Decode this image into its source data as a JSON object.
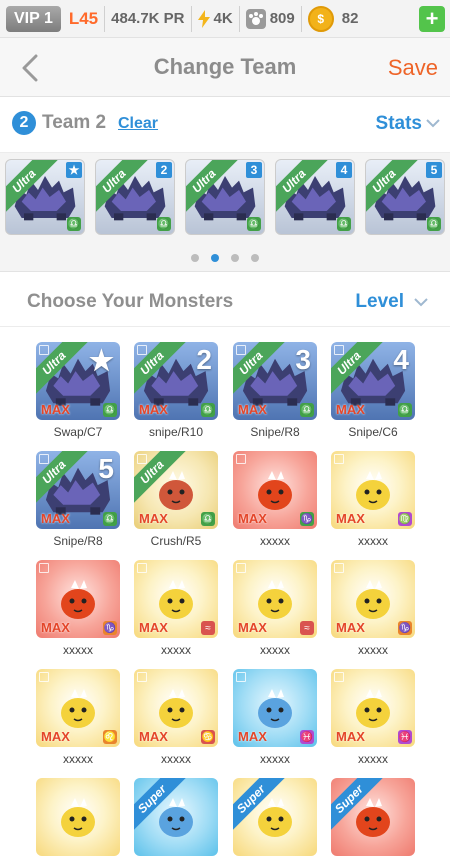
{
  "status": {
    "vip": "VIP 1",
    "level": "L45",
    "power": "484.7K PR",
    "energy": "4K",
    "food": "809",
    "gold": "82",
    "colors": {
      "accent": "#ee6428",
      "blue": "#2f8fd8",
      "green": "#4ba55a"
    }
  },
  "nav": {
    "title": "Change Team",
    "save": "Save"
  },
  "team": {
    "number": "2",
    "name": "Team 2",
    "clear": "Clear",
    "stats": "Stats"
  },
  "team_slots": [
    {
      "rank": "Ultra",
      "badge": "★"
    },
    {
      "rank": "Ultra",
      "badge": "2"
    },
    {
      "rank": "Ultra",
      "badge": "3"
    },
    {
      "rank": "Ultra",
      "badge": "4"
    },
    {
      "rank": "Ultra",
      "badge": "5"
    }
  ],
  "pager": {
    "active_index": 1,
    "count": 4
  },
  "monsters": {
    "title": "Choose Your Monsters",
    "sort": "Level"
  },
  "cards": [
    {
      "name": "Swap/C7",
      "rank": "Ultra",
      "badge": "★",
      "level": "MAX",
      "theme": "blue"
    },
    {
      "name": "snipe/R10",
      "rank": "Ultra",
      "badge": "2",
      "level": "MAX",
      "theme": "blue"
    },
    {
      "name": "Snipe/R8",
      "rank": "Ultra",
      "badge": "3",
      "level": "MAX",
      "theme": "blue"
    },
    {
      "name": "Snipe/C6",
      "rank": "Ultra",
      "badge": "4",
      "level": "MAX",
      "theme": "blue"
    },
    {
      "name": "Snipe/R8",
      "rank": "Ultra",
      "badge": "5",
      "level": "MAX",
      "theme": "blue"
    },
    {
      "name": "Crush/R5",
      "rank": "Ultra",
      "badge": "",
      "level": "MAX",
      "theme": "green"
    },
    {
      "name": "xxxxx",
      "rank": "",
      "badge": "",
      "level": "MAX",
      "theme": "red"
    },
    {
      "name": "xxxxx",
      "rank": "",
      "badge": "",
      "level": "MAX",
      "theme": "yellow"
    },
    {
      "name": "xxxxx",
      "rank": "",
      "badge": "",
      "level": "MAX",
      "theme": "red"
    },
    {
      "name": "xxxxx",
      "rank": "",
      "badge": "",
      "level": "MAX",
      "theme": "yellow"
    },
    {
      "name": "xxxxx",
      "rank": "",
      "badge": "",
      "level": "MAX",
      "theme": "yellow"
    },
    {
      "name": "xxxxx",
      "rank": "",
      "badge": "",
      "level": "MAX",
      "theme": "yellow"
    },
    {
      "name": "xxxxx",
      "rank": "",
      "badge": "",
      "level": "MAX",
      "theme": "yellow"
    },
    {
      "name": "xxxxx",
      "rank": "",
      "badge": "",
      "level": "MAX",
      "theme": "yellow"
    },
    {
      "name": "xxxxx",
      "rank": "",
      "badge": "",
      "level": "MAX",
      "theme": "cyan"
    },
    {
      "name": "xxxxx",
      "rank": "",
      "badge": "",
      "level": "MAX",
      "theme": "yellow"
    }
  ],
  "partial_row": [
    {
      "rank": "",
      "theme": "yellow"
    },
    {
      "rank": "Super",
      "theme": "cyan"
    },
    {
      "rank": "Super",
      "theme": "yellow"
    },
    {
      "rank": "Super",
      "theme": "red"
    }
  ]
}
